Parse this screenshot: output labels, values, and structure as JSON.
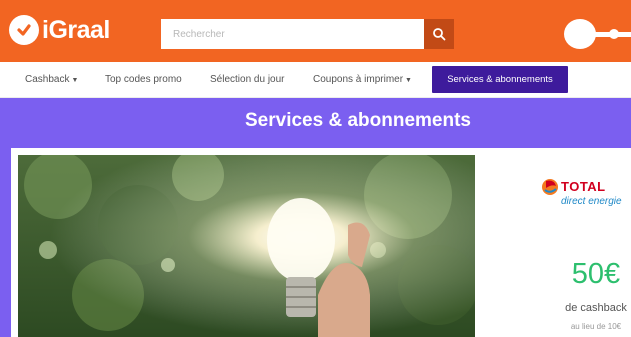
{
  "header": {
    "logo_text": "iGraal",
    "search_placeholder": "Rechercher"
  },
  "nav": {
    "items": [
      {
        "label": "Cashback",
        "dropdown": true
      },
      {
        "label": "Top codes promo",
        "dropdown": false
      },
      {
        "label": "Sélection du jour",
        "dropdown": false
      },
      {
        "label": "Coupons à imprimer",
        "dropdown": true
      }
    ],
    "active_label": "Services & abonnements"
  },
  "page": {
    "title": "Services & abonnements"
  },
  "offer": {
    "brand_name": "TOTAL",
    "brand_subtitle": "direct energie",
    "cashback_amount": "50€",
    "cashback_label": "de cashback",
    "previous_rate": "au lieu de 10€"
  },
  "colors": {
    "header_orange": "#f26522",
    "nav_active": "#3e1b9c",
    "band_purple": "#7b5ff0",
    "cashback_green": "#2dbf6e"
  }
}
